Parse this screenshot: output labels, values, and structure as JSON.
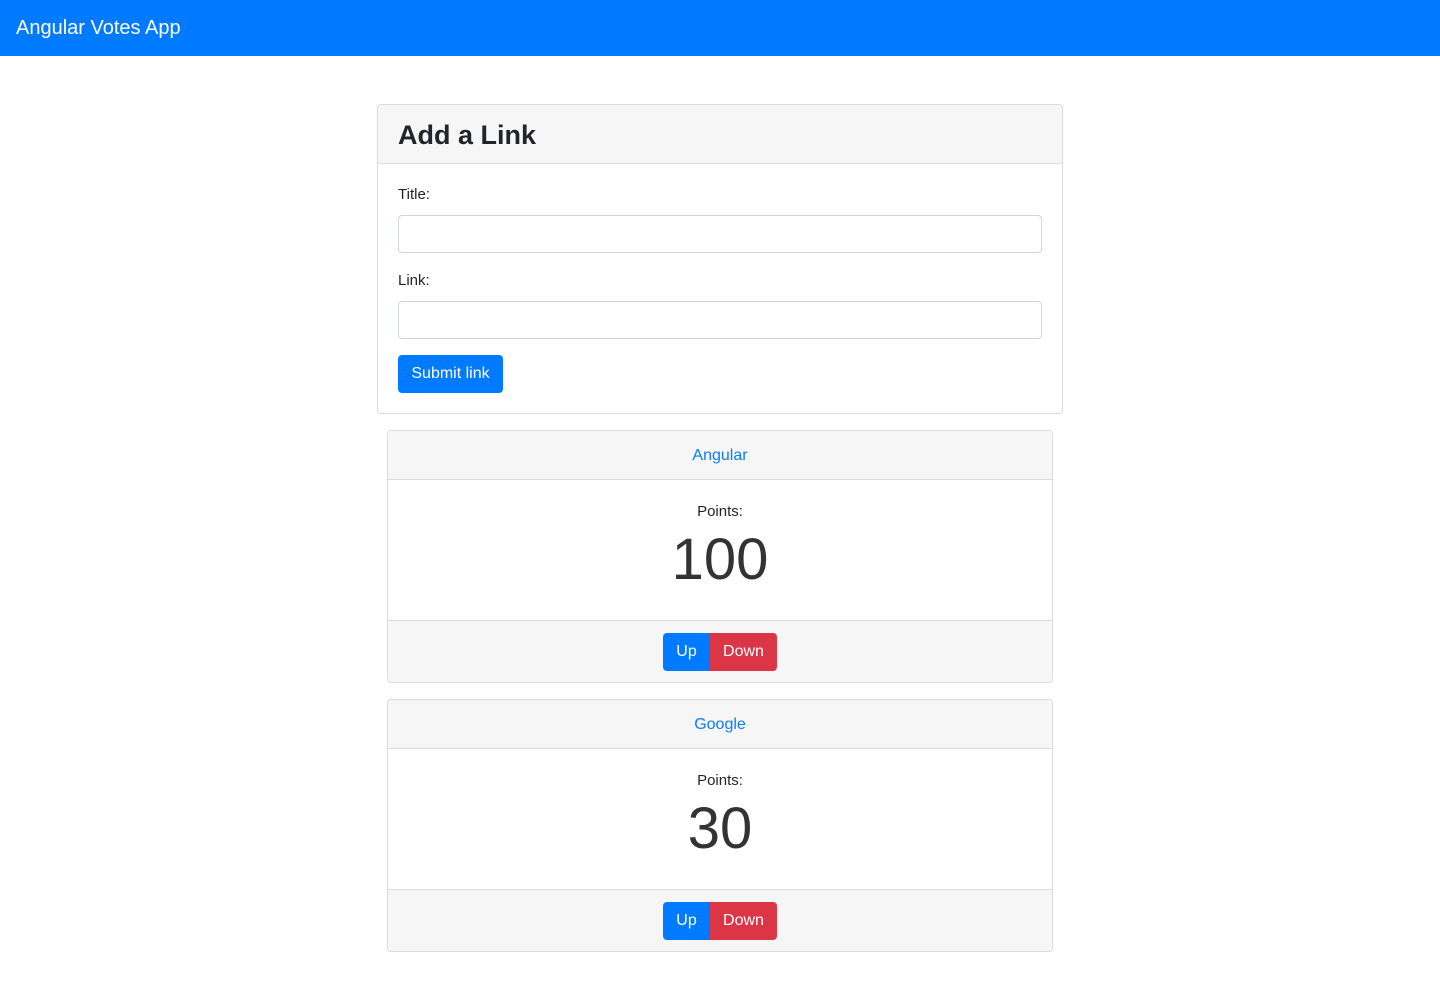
{
  "navbar": {
    "brand": "Angular Votes App"
  },
  "form": {
    "title": "Add a Link",
    "title_label": "Title:",
    "title_value": "",
    "link_label": "Link:",
    "link_value": "",
    "submit_label": "Submit link"
  },
  "links": [
    {
      "title": "Angular",
      "points_label": "Points:",
      "points": "100",
      "up_label": "Up",
      "down_label": "Down"
    },
    {
      "title": "Google",
      "points_label": "Points:",
      "points": "30",
      "up_label": "Up",
      "down_label": "Down"
    }
  ],
  "colors": {
    "primary": "#007bff",
    "danger": "#dc3545",
    "card_header": "#f6f6f6"
  }
}
